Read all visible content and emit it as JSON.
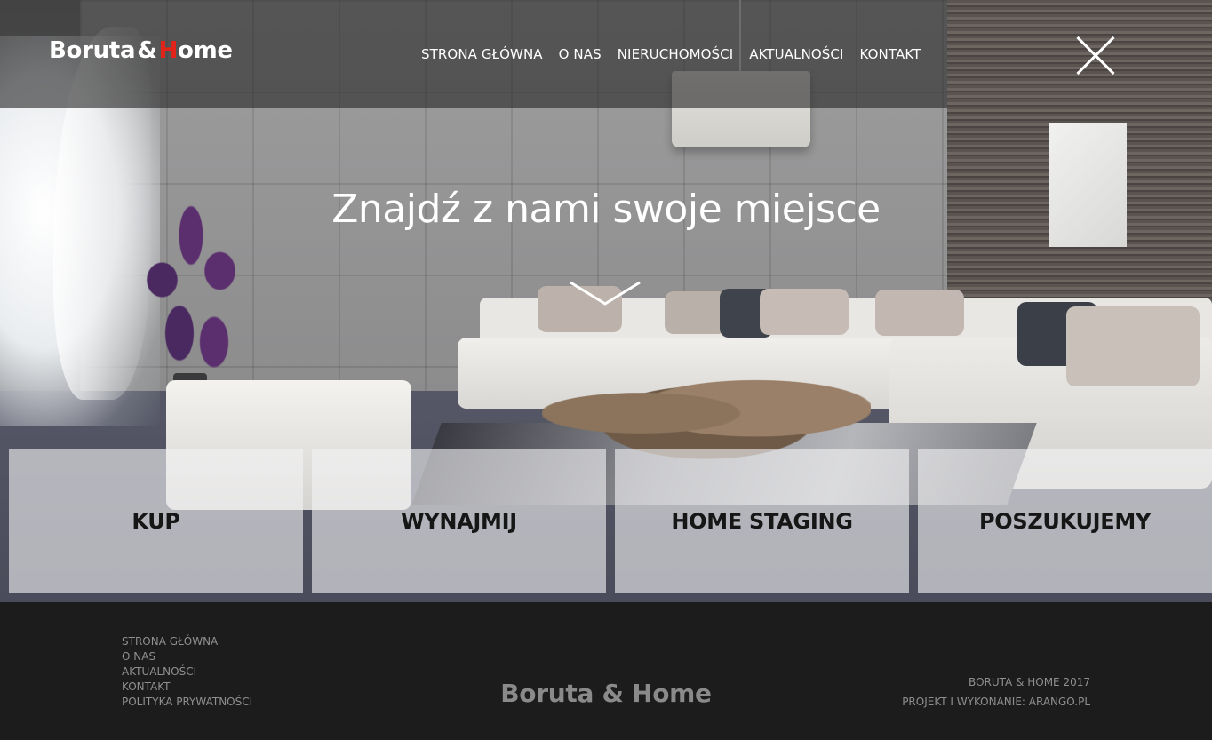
{
  "brand": {
    "logo_part1": "Boruta",
    "logo_amp": "&",
    "logo_h": "H",
    "logo_rest": "ome",
    "accent_red": "#e2231a"
  },
  "nav": {
    "items": [
      "STRONA GŁÓWNA",
      "O NAS",
      "NIERUCHOMOŚCI",
      "AKTUALNOŚCI",
      "KONTAKT"
    ]
  },
  "hero": {
    "headline": "Znajdź z nami swoje miejsce",
    "scroll_icon": "chevron-down-icon",
    "close_icon": "close-icon"
  },
  "tiles": [
    "KUP",
    "WYNAJMIJ",
    "HOME STAGING",
    "POSZUKUJEMY"
  ],
  "footer": {
    "links": [
      "STRONA GŁÓWNA",
      "O NAS",
      "AKTUALNOŚCI",
      "KONTAKT",
      "POLITYKA PRYWATNOŚCI"
    ],
    "logo": "Boruta & Home",
    "copyright": "BORUTA & HOME 2017",
    "credit": "PROJEKT I WYKONANIE: ARANGO.PL"
  }
}
